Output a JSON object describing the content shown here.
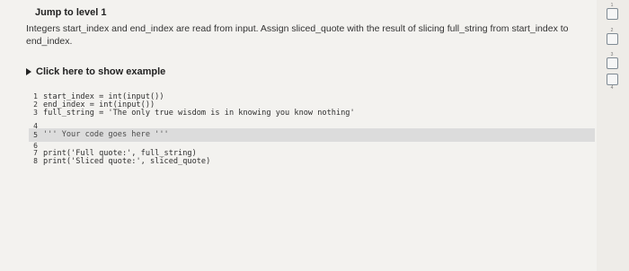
{
  "header": {
    "jump_label": "Jump to level 1"
  },
  "instructions": {
    "text": "Integers start_index and end_index are read from input. Assign sliced_quote with the result of slicing full_string from start_index to end_index."
  },
  "example": {
    "toggle_label": "Click here to show example"
  },
  "editor": {
    "lines": [
      {
        "num": "1",
        "code": "start_index = int(input())"
      },
      {
        "num": "2",
        "code": "end_index = int(input())"
      },
      {
        "num": "3",
        "code": "full_string = 'The only true wisdom is in knowing you know nothing'"
      },
      {
        "num": "4",
        "code": ""
      },
      {
        "num": "5",
        "code": "''' Your code goes here '''"
      },
      {
        "num": "6",
        "code": ""
      },
      {
        "num": "7",
        "code": "print('Full quote:', full_string)"
      },
      {
        "num": "8",
        "code": "print('Sliced quote:', sliced_quote)"
      }
    ]
  },
  "levels": [
    {
      "num": "1"
    },
    {
      "num": "2"
    },
    {
      "num": "3"
    },
    {
      "num": "4"
    }
  ],
  "colors": {
    "background": "#f3f2ef",
    "editable_line": "#dcdcdc",
    "level_border": "#7f8a93"
  }
}
